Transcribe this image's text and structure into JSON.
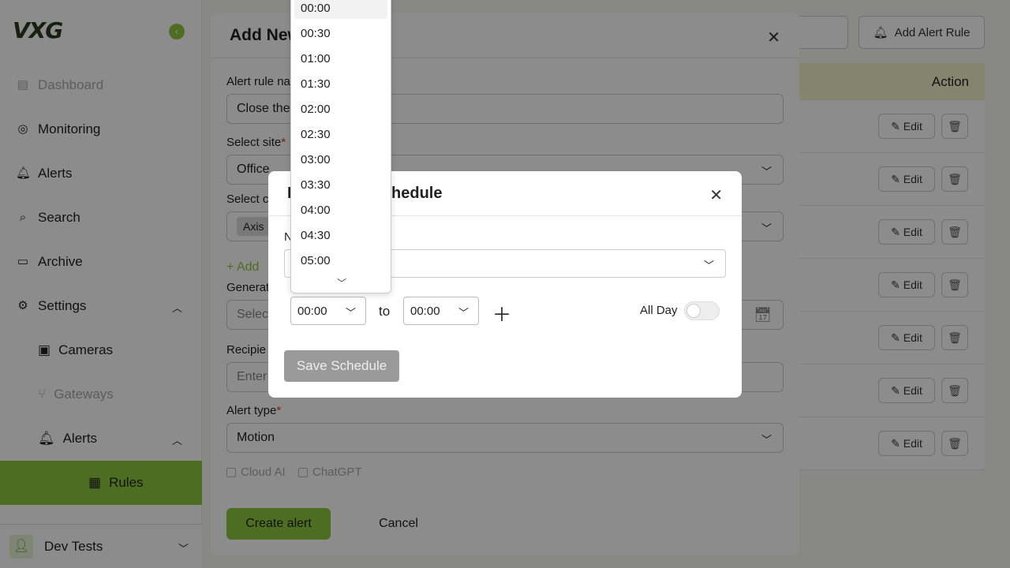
{
  "sidebar": {
    "logo": "VXG",
    "items": [
      {
        "label": "Dashboard",
        "icon": "file-icon"
      },
      {
        "label": "Monitoring",
        "icon": "person-icon"
      },
      {
        "label": "Alerts",
        "icon": "bell-icon"
      },
      {
        "label": "Search",
        "icon": "search-icon"
      },
      {
        "label": "Archive",
        "icon": "archive-icon"
      },
      {
        "label": "Settings",
        "icon": "gear-icon"
      },
      {
        "label": "Cameras",
        "icon": "camera-icon"
      },
      {
        "label": "Gateways",
        "icon": "gateway-icon"
      },
      {
        "label": "Alerts",
        "icon": "bell-icon"
      },
      {
        "label": "Rules",
        "icon": "clipboard-icon"
      }
    ],
    "user": "Dev Tests",
    "accent": "#8dc63f"
  },
  "header": {
    "add_rule": "Add Alert Rule"
  },
  "table": {
    "action_header": "Action",
    "edit_label": "Edit",
    "row_count": 7
  },
  "add_modal": {
    "title": "Add New",
    "rule_name_label": "Alert rule na",
    "rule_name_value": "Close the",
    "site_label": "Select site",
    "site_value": "Office",
    "camera_label": "Select c",
    "camera_chip": "Axis",
    "add_link": "+ Add",
    "generate_label": "Generat",
    "generate_placeholder": "Select",
    "recipients_label": "Recipie",
    "recipients_placeholder": "Enter",
    "alert_type_label": "Alert type",
    "alert_type_value": "Motion",
    "checkbox_cloud": "Cloud AI",
    "checkbox_chatgpt": "ChatGPT",
    "create_btn": "Create alert",
    "cancel_btn": "Cancel",
    "required_mark": "*"
  },
  "schedule_modal": {
    "title_prefix": "I",
    "title_suffix": "Schedule",
    "label": "N",
    "from_time": "00:00",
    "to_label": "to",
    "to_time": "00:00",
    "all_day_label": "All Day",
    "all_day_on": false,
    "save_btn": "Save Schedule"
  },
  "time_dropdown": {
    "options": [
      "00:00",
      "00:30",
      "01:00",
      "01:30",
      "02:00",
      "02:30",
      "03:00",
      "03:30",
      "04:00",
      "04:30",
      "05:00"
    ],
    "selected": "00:00"
  }
}
